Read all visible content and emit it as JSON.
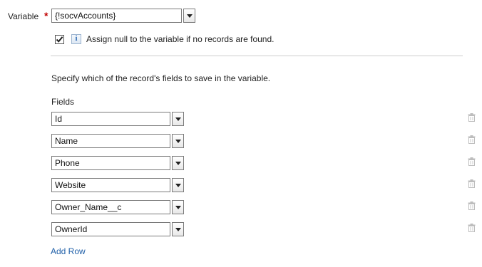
{
  "variable": {
    "label": "Variable",
    "required_marker": "*",
    "value": "{!socvAccounts}"
  },
  "assign_null": {
    "checked": true,
    "icon": "info-icon",
    "info_glyph": "i",
    "label": "Assign null to the variable if no records are found."
  },
  "instructions": "Specify which of the record's fields to save in the variable.",
  "fields_label": "Fields",
  "fields": [
    {
      "value": "Id"
    },
    {
      "value": "Name"
    },
    {
      "value": "Phone"
    },
    {
      "value": "Website"
    },
    {
      "value": "Owner_Name__c"
    },
    {
      "value": "OwnerId"
    }
  ],
  "add_row_label": "Add Row",
  "colors": {
    "required": "#c00000",
    "link": "#1f5fa8",
    "divider": "#cccccc"
  }
}
